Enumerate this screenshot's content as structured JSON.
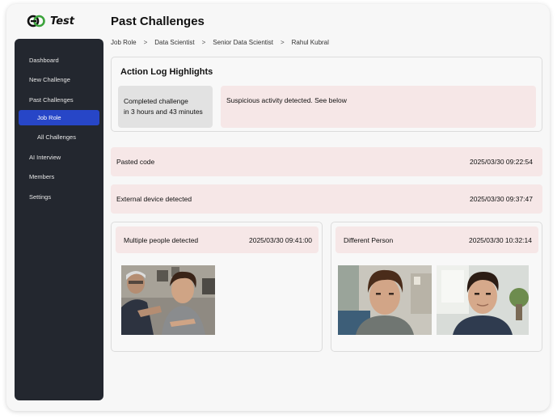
{
  "app": {
    "name": "Test"
  },
  "page": {
    "title": "Past Challenges"
  },
  "sidebar": {
    "items": [
      {
        "label": "Dashboard"
      },
      {
        "label": "New Challenge"
      },
      {
        "label": "Past Challenges"
      },
      {
        "label": "Job Role"
      },
      {
        "label": "All Challenges"
      },
      {
        "label": "AI Interview"
      },
      {
        "label": "Members"
      },
      {
        "label": "Settings"
      }
    ]
  },
  "breadcrumb": {
    "items": [
      "Job Role",
      "Data Scientist",
      "Senior Data Scientist",
      "Rahul Kubral"
    ],
    "separator": ">"
  },
  "highlights": {
    "title": "Action Log Highlights",
    "completed_line1": "Completed challenge",
    "completed_line2": "in 3 hours and 43 minutes",
    "alert": "Suspicious activity detected. See below"
  },
  "events": [
    {
      "label": "Pasted code",
      "time": "2025/03/30 09:22:54"
    },
    {
      "label": "External device detected",
      "time": "2025/03/30 09:37:47"
    },
    {
      "label": "Multiple people detected",
      "time": "2025/03/30 09:41:00"
    },
    {
      "label": "Different Person",
      "time": "2025/03/30 10:32:14"
    }
  ],
  "colors": {
    "sidebar_bg": "#23272f",
    "active_nav": "#2746c7",
    "alert_bg": "#f6e7e7",
    "stat_bg": "#e2e2e2",
    "logo_green": "#3ba33b"
  }
}
